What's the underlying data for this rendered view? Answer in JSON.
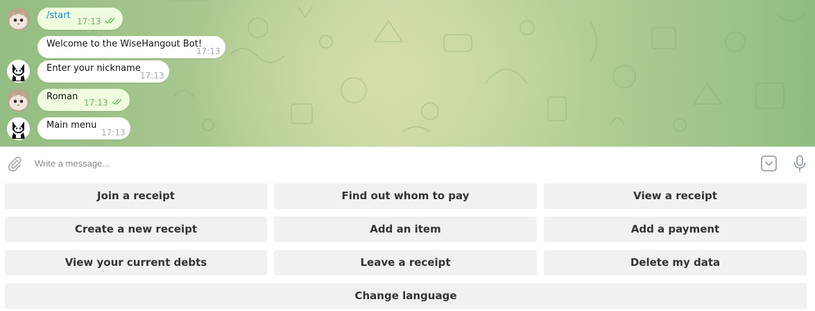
{
  "messages": [
    {
      "text": "/start",
      "time": "17:13",
      "read": true
    },
    {
      "text": "Welcome to the WiseHangout Bot!",
      "time": "17:13"
    },
    {
      "text": "Enter your nickname",
      "time": "17:13"
    },
    {
      "text": "Roman",
      "time": "17:13",
      "read": true
    },
    {
      "text": "Main menu",
      "time": "17:13"
    }
  ],
  "composer": {
    "placeholder": "Write a message..."
  },
  "keyboard": [
    [
      "Join a receipt",
      "Find out whom to pay",
      "View a receipt"
    ],
    [
      "Create a new receipt",
      "Add an item",
      "Add a payment"
    ],
    [
      "View your current debts",
      "Leave a receipt",
      "Delete my data"
    ],
    [
      "Change language"
    ]
  ],
  "colors": {
    "outgoing_bubble": "#effdde",
    "incoming_bubble": "#ffffff",
    "command_link": "#168acd",
    "read_tick": "#5fba5a",
    "key_bg": "#f1f1f1"
  },
  "icons": [
    "paperclip-icon",
    "keyboard-toggle-icon",
    "microphone-icon",
    "double-check-icon"
  ]
}
